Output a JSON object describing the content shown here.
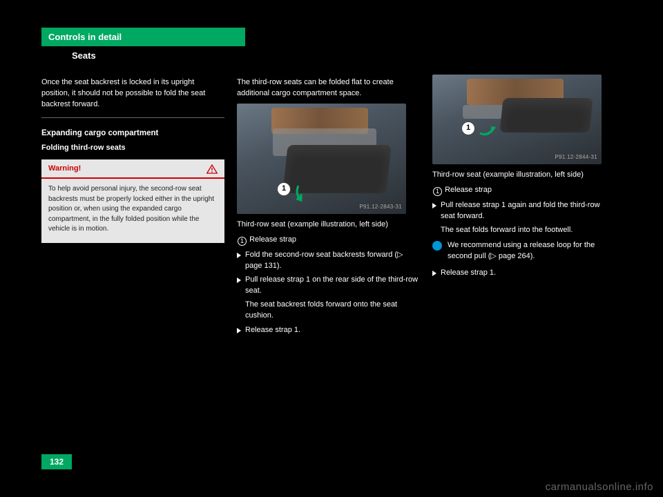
{
  "header": {
    "tab": "Controls in detail",
    "section": "Seats"
  },
  "col1": {
    "intro": "Once the seat backrest is locked in its upright position, it should not be possible to fold the seat backrest forward.",
    "h3": "Expanding cargo compartment",
    "h4": "Folding third-row seats",
    "warning": {
      "title": "Warning!",
      "body": "To help avoid personal injury, the second-row seat backrests must be properly locked either in the upright position or, when using the expanded cargo compartment, in the fully folded position while the vehicle is in motion."
    }
  },
  "col2": {
    "lead": "The third-row seats can be folded flat to create additional cargo compartment space.",
    "photo_tag": "P91.12-2843-31",
    "callout": "1",
    "caption_title": "Third-row seat (example illustration, left side)",
    "caption_item": "Release strap",
    "steps": [
      "Fold the second-row seat backrests forward (▷ page 131).",
      "Pull release strap 1 on the rear side of the third-row seat.",
      "The seat backrest folds forward onto the seat cushion.",
      "Release strap 1."
    ]
  },
  "col3": {
    "photo_tag": "P91.12-2844-31",
    "callout": "1",
    "caption_title": "Third-row seat (example illustration, left side)",
    "caption_item": "Release strap",
    "steps": [
      "Pull release strap 1 again and fold the third-row seat forward.",
      "The seat folds forward into the footwell."
    ],
    "note": "We recommend using a release loop for the second pull (▷ page 264).",
    "steps2": [
      "Release strap 1."
    ]
  },
  "pagenum": "132",
  "watermark": "carmanualsonline.info"
}
